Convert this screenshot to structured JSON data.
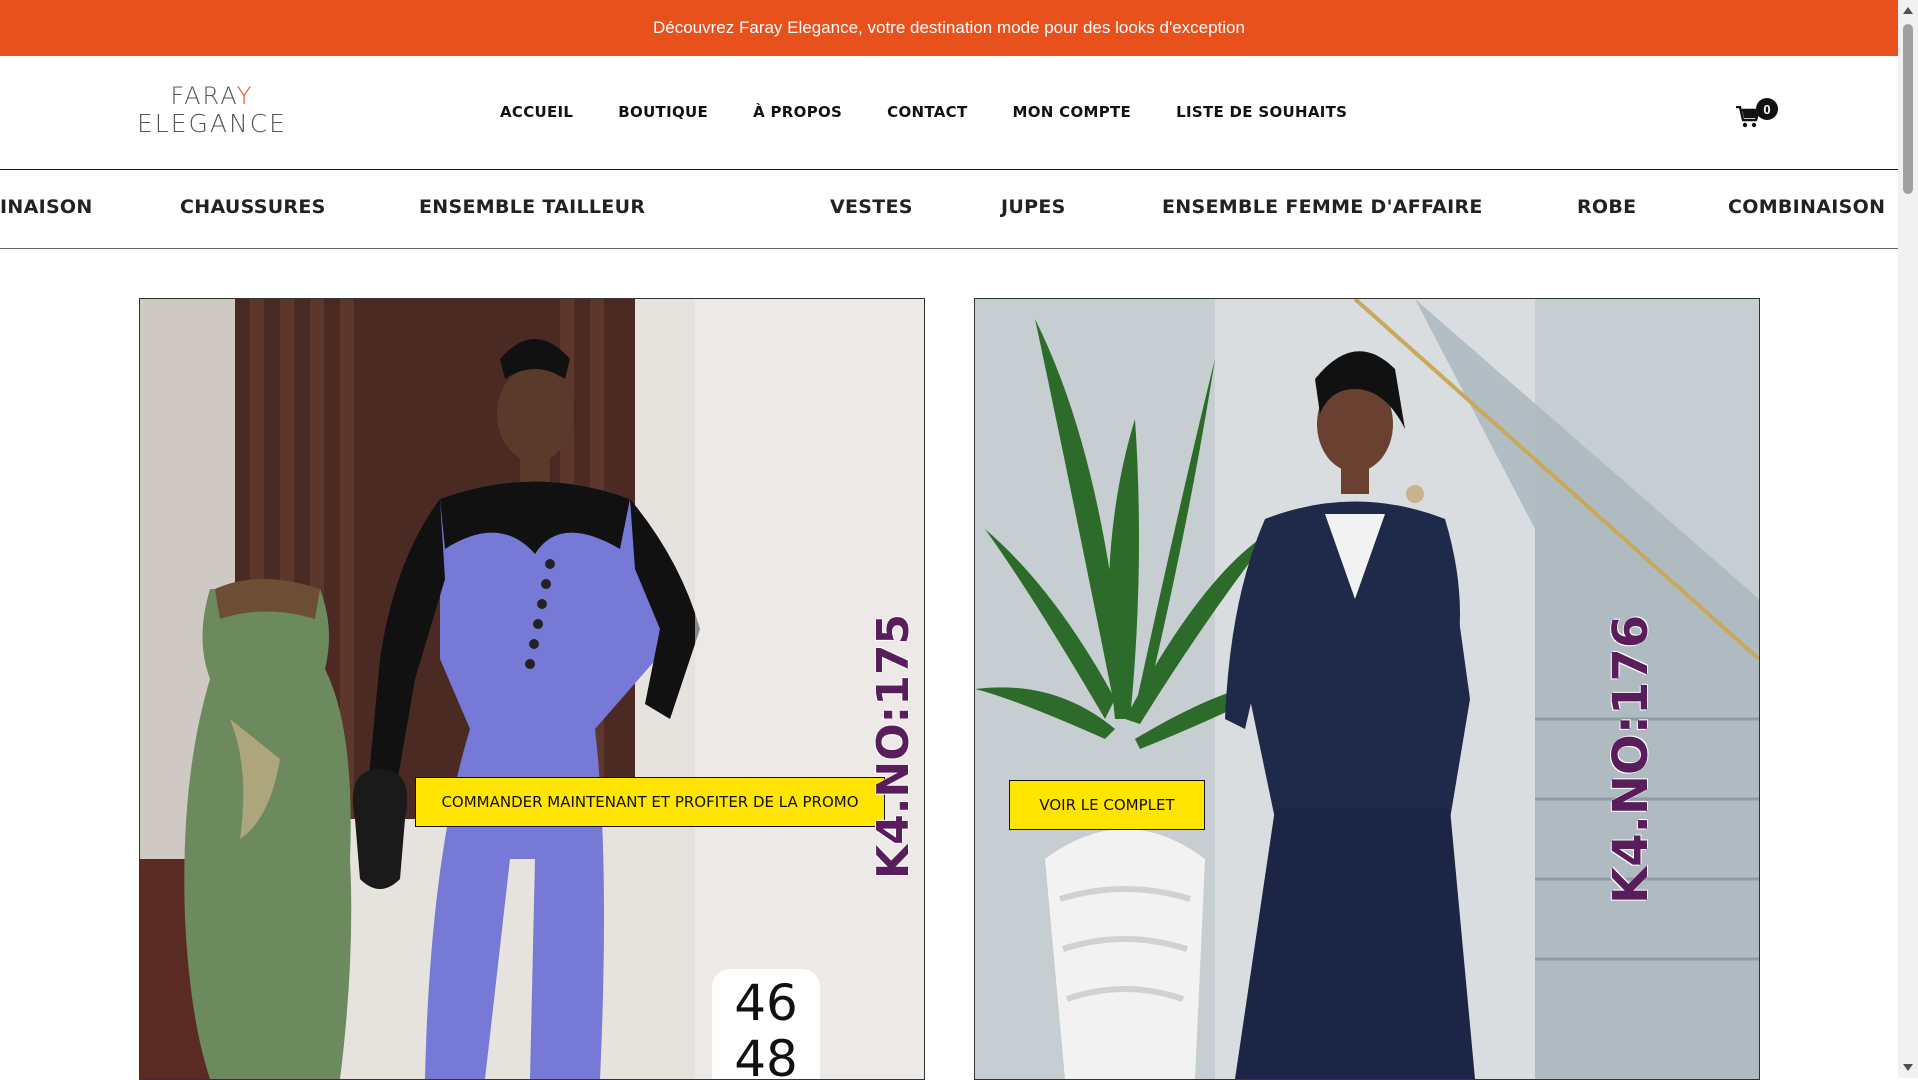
{
  "promo": {
    "text": "Découvrez Faray Elegance, votre destination mode pour des looks d'exception"
  },
  "logo": {
    "line1_main": "FARA",
    "line1_accent": "Y",
    "line2": "ELEGANCE"
  },
  "nav": {
    "items": [
      "ACCUEIL",
      "BOUTIQUE",
      "À PROPOS",
      "CONTACT",
      "MON COMPTE",
      "LISTE DE SOUHAITS"
    ]
  },
  "cart": {
    "count": "0",
    "icon": "shopping-cart-icon"
  },
  "categories": {
    "items": [
      "INAISON",
      "CHAUSSURES",
      "ENSEMBLE TAILLEUR",
      "VESTES",
      "JUPES",
      "ENSEMBLE FEMME D'AFFAIRE",
      "ROBE",
      "COMBINAISON"
    ]
  },
  "products": [
    {
      "cta": "COMMANDER MAINTENANT ET PROFITER DE LA PROMO",
      "ref": "K4.NO:175",
      "sizes": [
        "46",
        "48"
      ]
    },
    {
      "cta": "VOIR LE COMPLET",
      "ref": "K4.NO:176"
    }
  ],
  "colors": {
    "accent": "#e8501c",
    "button": "#ffe500",
    "ref_text": "#5a1d5c"
  }
}
